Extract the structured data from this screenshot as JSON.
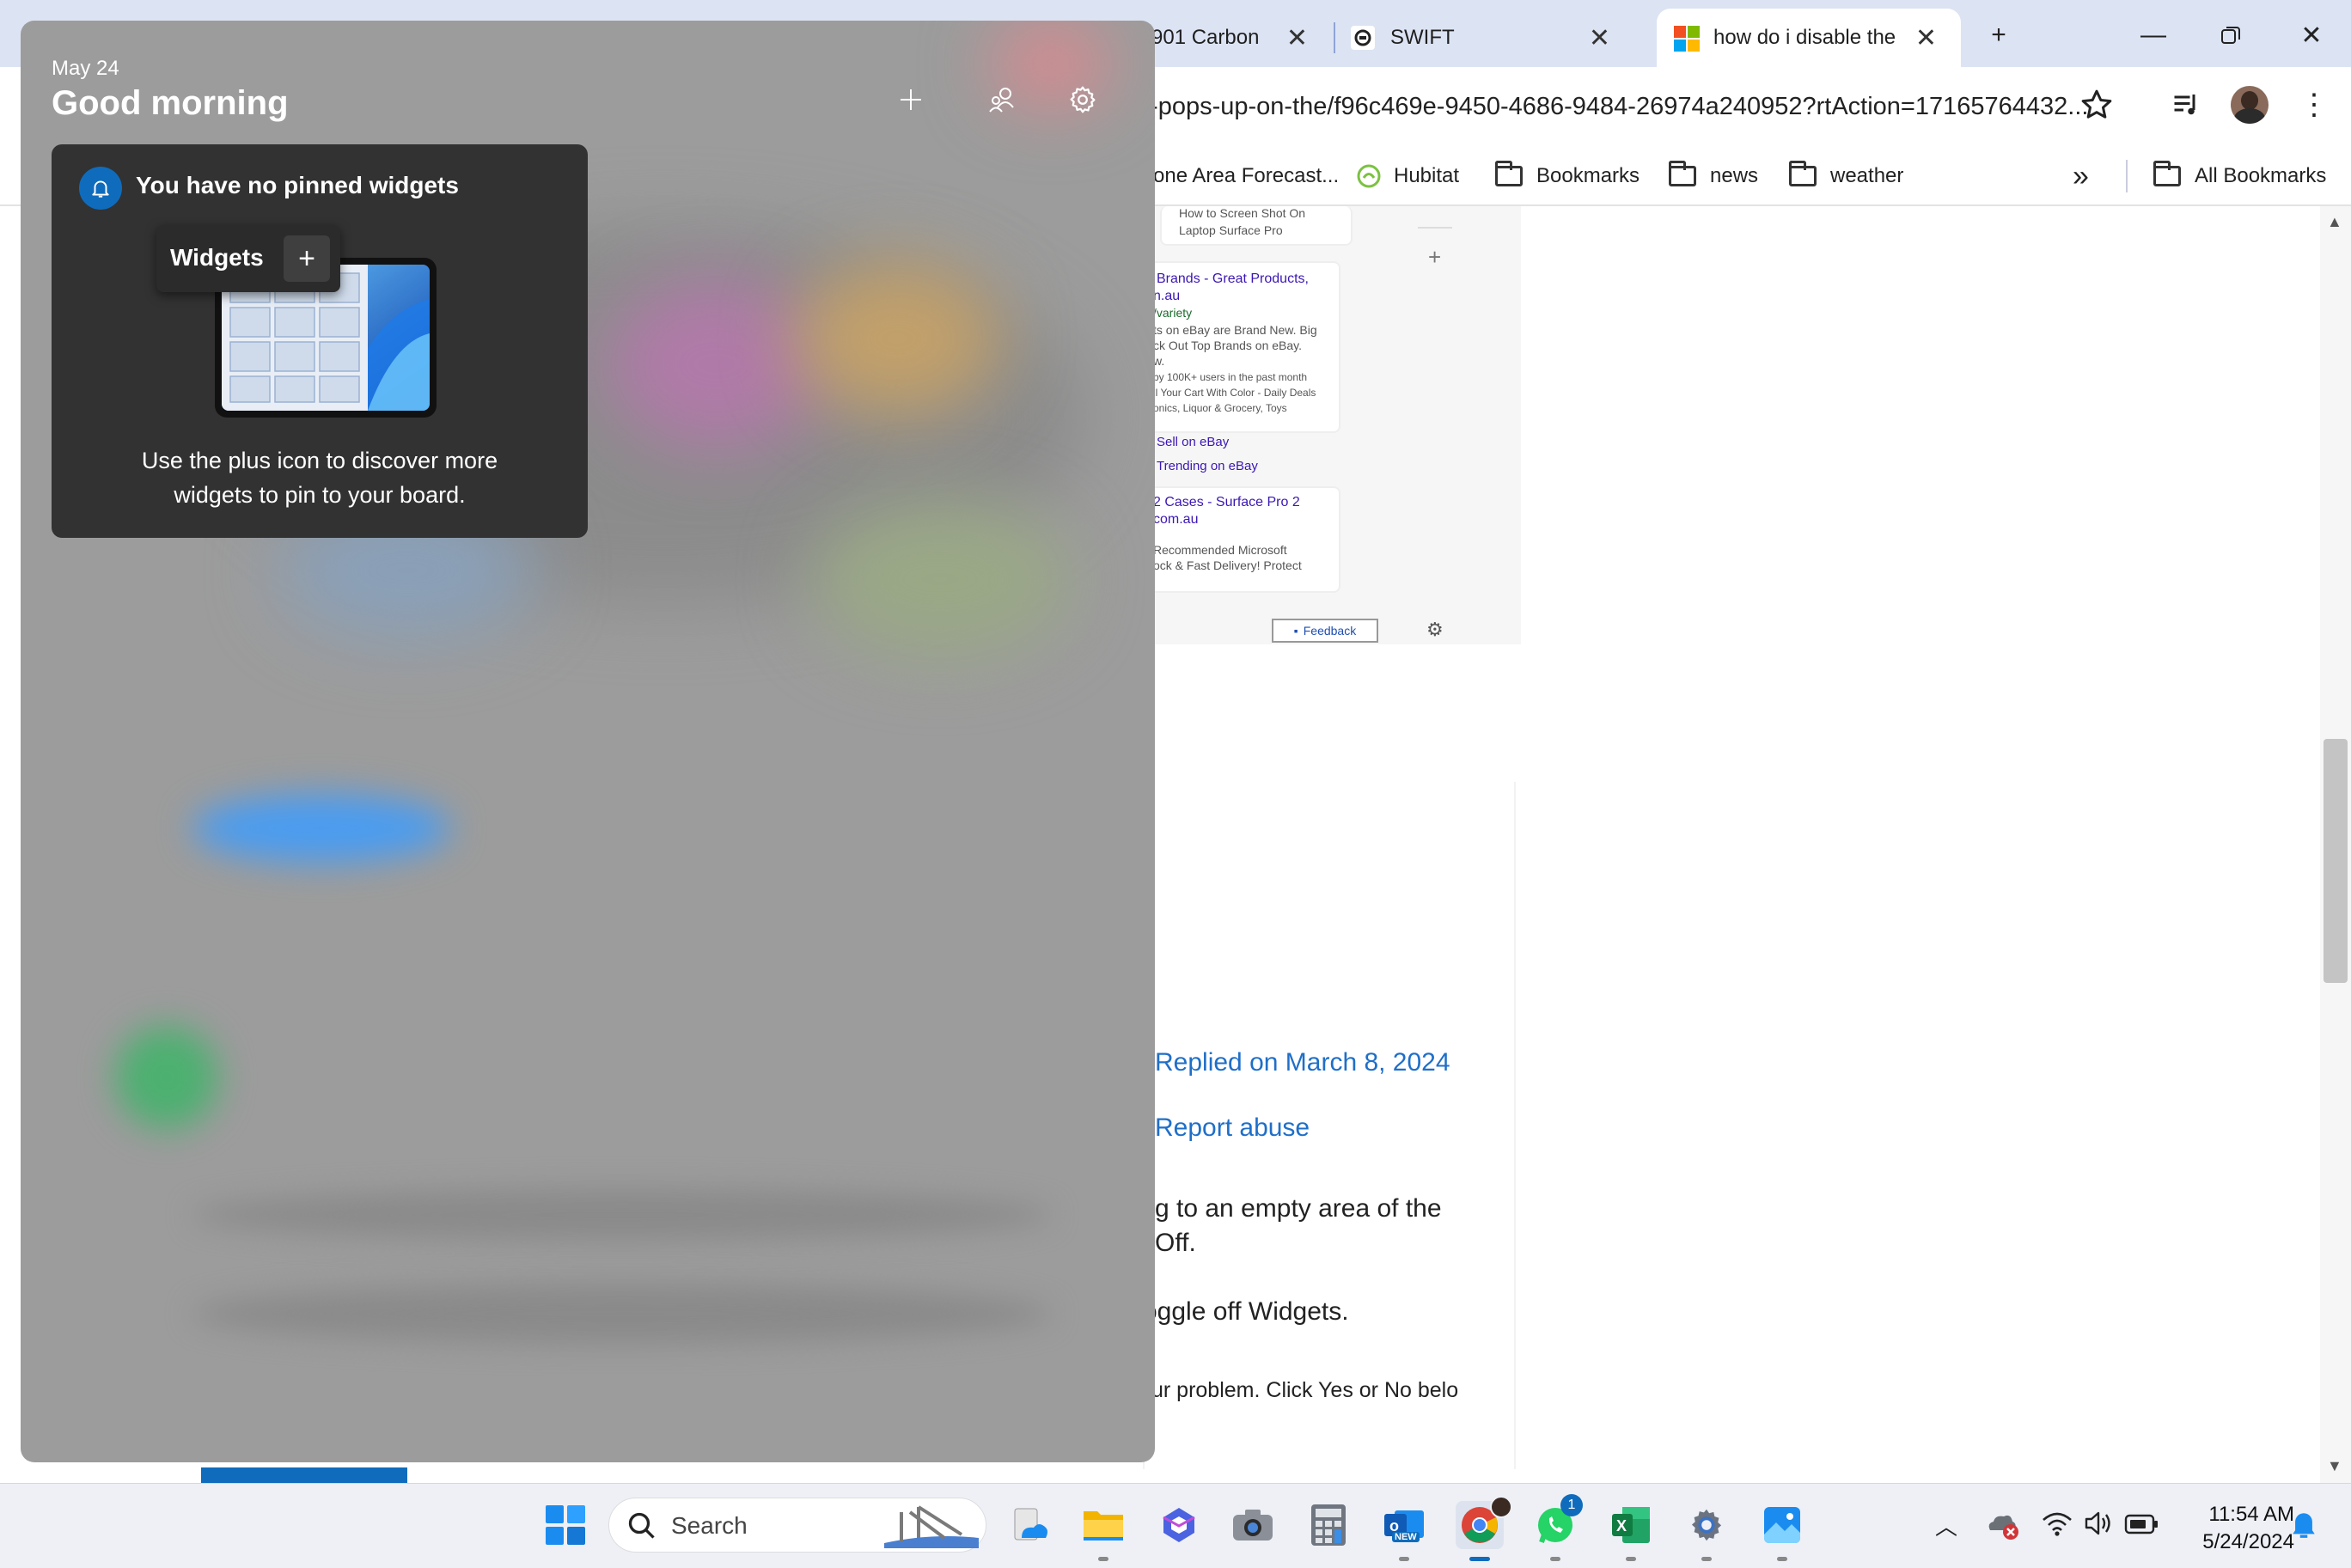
{
  "browser": {
    "tabs": [
      {
        "label": "901 Carbon",
        "active": false
      },
      {
        "label": "SWIFT",
        "active": false
      },
      {
        "label": "how do i disable the",
        "active": true
      }
    ],
    "new_tab_label": "+",
    "url": "t-pops-up-on-the/f96c469e-9450-4686-9484-26974a240952?rtAction=17165764432...",
    "bookmarks": [
      {
        "label": "one Area Forecast...",
        "icon": "page-icon"
      },
      {
        "label": "Hubitat",
        "icon": "hubitat-icon"
      },
      {
        "label": "Bookmarks",
        "icon": "folder-icon"
      },
      {
        "label": "news",
        "icon": "folder-icon"
      },
      {
        "label": "weather",
        "icon": "folder-icon"
      }
    ],
    "more_bookmarks": "»",
    "all_bookmarks": "All Bookmarks"
  },
  "page": {
    "ad_panel": {
      "top_card": [
        "How to Screen Shot On",
        "Laptop Surface Pro"
      ],
      "card1": {
        "title": [
          "Brands - Great Products,",
          "n.au"
        ],
        "url": "/variety",
        "lines": [
          "ts on eBay are Brand New. Big",
          "ck Out Top Brands on eBay.",
          "w."
        ],
        "meta": [
          "by 100K+ users in the past month",
          "ll Your Cart With Color - Daily Deals",
          "onics, Liquor & Grocery, Toys"
        ],
        "links": [
          "Sell on eBay",
          "Trending on eBay"
        ]
      },
      "card2": {
        "title": [
          "2 Cases - Surface Pro 2",
          "com.au"
        ],
        "lines": [
          "Recommended Microsoft",
          "ock & Fast Delivery! Protect"
        ]
      },
      "feedback": "Feedback",
      "plus": "+"
    },
    "replied": "Replied on March 8, 2024",
    "report": "Report abuse",
    "answer_lines": [
      "g to an empty area of the",
      " Off.",
      "oggle off Widgets."
    ],
    "footer_line": "ur problem. Click Yes or No belo"
  },
  "widgets": {
    "date": "May 24",
    "greeting": "Good morning",
    "header_buttons": [
      "plus-icon",
      "people-icon",
      "gear-icon"
    ],
    "no_widgets_title": "You have no pinned widgets",
    "chip_label": "Widgets",
    "chip_plus": "+",
    "body": "Use the plus icon to discover more widgets to pin to your board."
  },
  "taskbar": {
    "search_label": "Search",
    "apps": [
      "start-icon",
      "onedrive-icon",
      "file-explorer-icon",
      "copilot-icon",
      "camera-icon",
      "calculator-icon",
      "outlook-new-icon",
      "chrome-icon",
      "whatsapp-icon",
      "excel-icon",
      "settings-icon",
      "photos-icon"
    ],
    "outlook_badge": "NEW",
    "whatsapp_badge": "1",
    "time": "11:54 AM",
    "date": "5/24/2024"
  },
  "colors": {
    "accent": "#0f6cbd",
    "link": "#1f6fc8",
    "tabstrip": "#dce3f3",
    "widget_card": "#323232"
  }
}
